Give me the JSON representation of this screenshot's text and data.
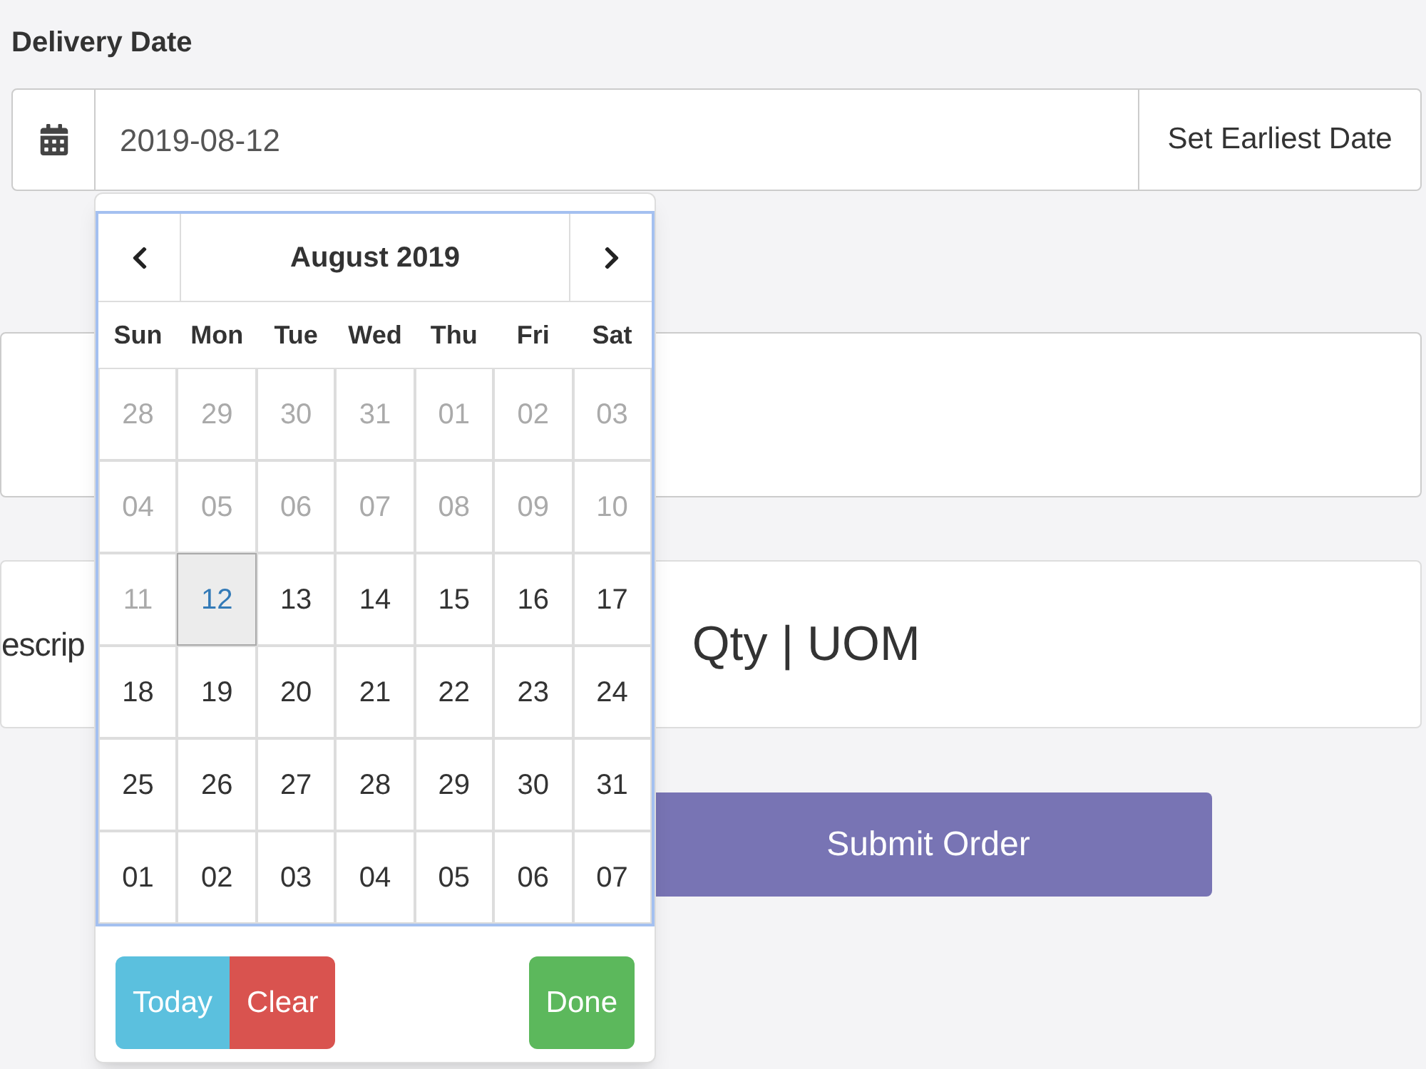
{
  "delivery_date": {
    "label": "Delivery Date",
    "value": "2019-08-12",
    "button": "Set Earliest Date"
  },
  "datepicker": {
    "month": "August 2019",
    "weekdays": [
      "Sun",
      "Mon",
      "Tue",
      "Wed",
      "Thu",
      "Fri",
      "Sat"
    ],
    "weeks": [
      [
        {
          "day": "28",
          "disabled": true,
          "selected": false
        },
        {
          "day": "29",
          "disabled": true,
          "selected": false
        },
        {
          "day": "30",
          "disabled": true,
          "selected": false
        },
        {
          "day": "31",
          "disabled": true,
          "selected": false
        },
        {
          "day": "01",
          "disabled": true,
          "selected": false
        },
        {
          "day": "02",
          "disabled": true,
          "selected": false
        },
        {
          "day": "03",
          "disabled": true,
          "selected": false
        }
      ],
      [
        {
          "day": "04",
          "disabled": true,
          "selected": false
        },
        {
          "day": "05",
          "disabled": true,
          "selected": false
        },
        {
          "day": "06",
          "disabled": true,
          "selected": false
        },
        {
          "day": "07",
          "disabled": true,
          "selected": false
        },
        {
          "day": "08",
          "disabled": true,
          "selected": false
        },
        {
          "day": "09",
          "disabled": true,
          "selected": false
        },
        {
          "day": "10",
          "disabled": true,
          "selected": false
        }
      ],
      [
        {
          "day": "11",
          "disabled": true,
          "selected": false
        },
        {
          "day": "12",
          "disabled": false,
          "selected": true
        },
        {
          "day": "13",
          "disabled": false,
          "selected": false
        },
        {
          "day": "14",
          "disabled": false,
          "selected": false
        },
        {
          "day": "15",
          "disabled": false,
          "selected": false
        },
        {
          "day": "16",
          "disabled": false,
          "selected": false
        },
        {
          "day": "17",
          "disabled": false,
          "selected": false
        }
      ],
      [
        {
          "day": "18",
          "disabled": false,
          "selected": false
        },
        {
          "day": "19",
          "disabled": false,
          "selected": false
        },
        {
          "day": "20",
          "disabled": false,
          "selected": false
        },
        {
          "day": "21",
          "disabled": false,
          "selected": false
        },
        {
          "day": "22",
          "disabled": false,
          "selected": false
        },
        {
          "day": "23",
          "disabled": false,
          "selected": false
        },
        {
          "day": "24",
          "disabled": false,
          "selected": false
        }
      ],
      [
        {
          "day": "25",
          "disabled": false,
          "selected": false
        },
        {
          "day": "26",
          "disabled": false,
          "selected": false
        },
        {
          "day": "27",
          "disabled": false,
          "selected": false
        },
        {
          "day": "28",
          "disabled": false,
          "selected": false
        },
        {
          "day": "29",
          "disabled": false,
          "selected": false
        },
        {
          "day": "30",
          "disabled": false,
          "selected": false
        },
        {
          "day": "31",
          "disabled": false,
          "selected": false
        }
      ],
      [
        {
          "day": "01",
          "disabled": false,
          "selected": false
        },
        {
          "day": "02",
          "disabled": false,
          "selected": false
        },
        {
          "day": "03",
          "disabled": false,
          "selected": false
        },
        {
          "day": "04",
          "disabled": false,
          "selected": false
        },
        {
          "day": "05",
          "disabled": false,
          "selected": false
        },
        {
          "day": "06",
          "disabled": false,
          "selected": false
        },
        {
          "day": "07",
          "disabled": false,
          "selected": false
        }
      ]
    ],
    "buttons": [
      {
        "label": "Today",
        "kind": "today"
      },
      {
        "label": "Clear",
        "kind": "clear"
      },
      {
        "label": "Done",
        "kind": "done"
      }
    ]
  },
  "item_row": {
    "description": "escrip",
    "qty_uom": "Qty | UOM"
  },
  "submit": "Submit Order"
}
